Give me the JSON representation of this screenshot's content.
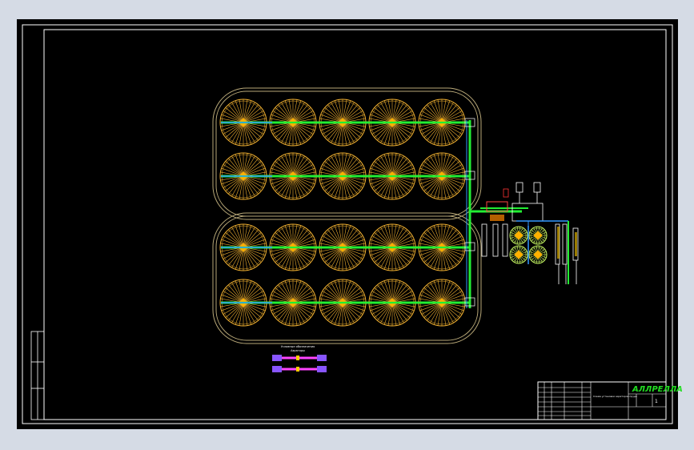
{
  "colors": {
    "window_bg": "#d5dbe5",
    "sheet_bg": "#000000",
    "frame": "#ffffff",
    "pond_outline": "#b8a878",
    "aerator": "#f0b030",
    "aerator_center": "#ffb000",
    "pipe_main": "#22ee33",
    "pipe_axis": "#3399ff",
    "equipment": "#ffffff",
    "title_logo": "#22dd22"
  },
  "legend_block": {
    "caption_line1": "Условные обозначения",
    "caption_line2": "Аэраторы"
  },
  "title_block": {
    "logo": "АЛЛРЕЛЛА",
    "sheet_number": "1",
    "drawing_name": "Схема установки аэраторов пруда"
  },
  "pond_layout": {
    "basins": 2,
    "aerator_rows": 4,
    "aerators_per_row": 5,
    "auxiliary_wheels": 4
  }
}
